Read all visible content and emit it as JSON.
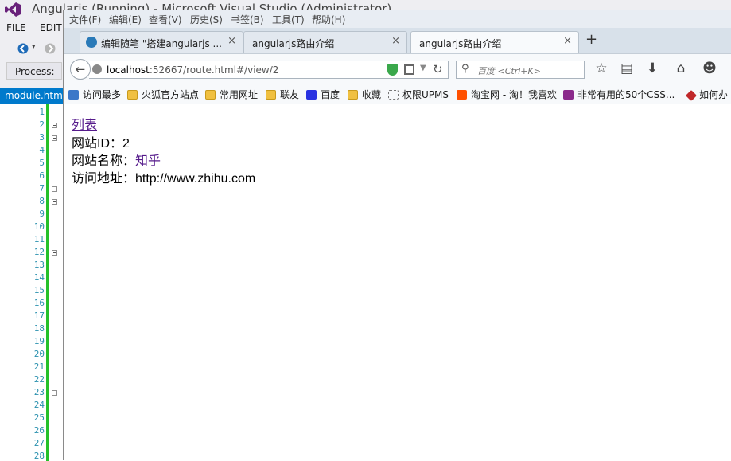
{
  "vs": {
    "title": "Angularjs (Running) - Microsoft Visual Studio (Administrator)",
    "menu": [
      "FILE",
      "EDIT"
    ],
    "process_label": "Process:",
    "doc_tab": "module.html",
    "line_numbers": [
      "1",
      "2",
      "3",
      "4",
      "5",
      "6",
      "7",
      "8",
      "9",
      "10",
      "11",
      "12",
      "13",
      "14",
      "15",
      "16",
      "17",
      "18",
      "19",
      "20",
      "21",
      "22",
      "23",
      "24",
      "25",
      "26",
      "27",
      "28"
    ],
    "changebar_color": "#25c12a",
    "accent_color": "#007acc"
  },
  "firefox": {
    "menu": [
      "文件(F)",
      "编辑(E)",
      "查看(V)",
      "历史(S)",
      "书签(B)",
      "工具(T)",
      "帮助(H)"
    ],
    "tabs": [
      {
        "label": "编辑随笔 \"搭建angularjs ...",
        "close": "×",
        "active": false
      },
      {
        "label": "angularjs路由介绍",
        "close": "×",
        "active": false
      },
      {
        "label": "angularjs路由介绍",
        "close": "×",
        "active": true
      }
    ],
    "new_tab": "+",
    "url": {
      "host": "localhost",
      "rest": ":52667/route.html#/view/2"
    },
    "search_placeholder": "百度 <Ctrl+K>",
    "bookmarks": [
      "访问最多",
      "火狐官方站点",
      "常用网址",
      "联友",
      "百度",
      "收藏",
      "权限UPMS",
      "淘宝网 - 淘！我喜欢",
      "非常有用的50个CSS...",
      "如何办"
    ]
  },
  "content": {
    "list_link": "列表",
    "site_id_label": "网站ID：",
    "site_id": "2",
    "site_name_label": "网站名称：",
    "site_name": "知乎",
    "site_url_label": "访问地址：",
    "site_url": "http://www.zhihu.com",
    "link_color": "#551a8b"
  }
}
